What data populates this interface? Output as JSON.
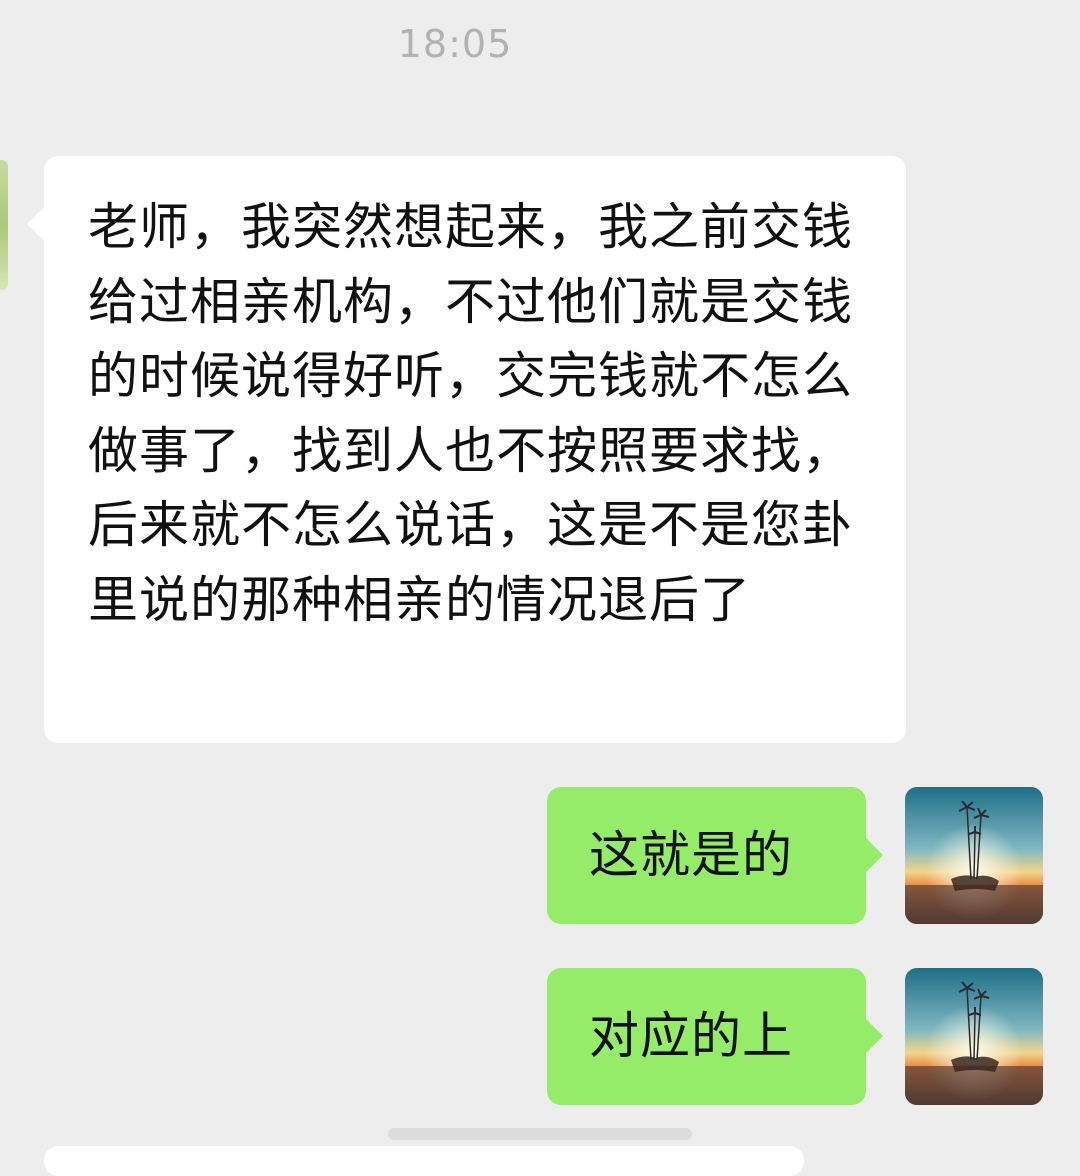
{
  "chat": {
    "timestamp": "18:05",
    "messages": [
      {
        "direction": "incoming",
        "text": "老师，我突然想起来，我之前交钱给过相亲机构，不过他们就是交钱的时候说得好听，交完钱就不怎么做事了，找到人也不按照要求找，后来就不怎么说话，这是不是您卦里说的那种相亲的情况退后了"
      },
      {
        "direction": "outgoing",
        "text": "这就是的"
      },
      {
        "direction": "outgoing",
        "text": "对应的上"
      }
    ]
  },
  "colors": {
    "background": "#ededed",
    "incoming_bubble": "#ffffff",
    "outgoing_bubble": "#95ec69",
    "timestamp_text": "#b2b2b2"
  },
  "icons": {
    "sender_avatar": "avatar-partial-icon",
    "self_avatar": "sunset-palm-hand-avatar"
  }
}
